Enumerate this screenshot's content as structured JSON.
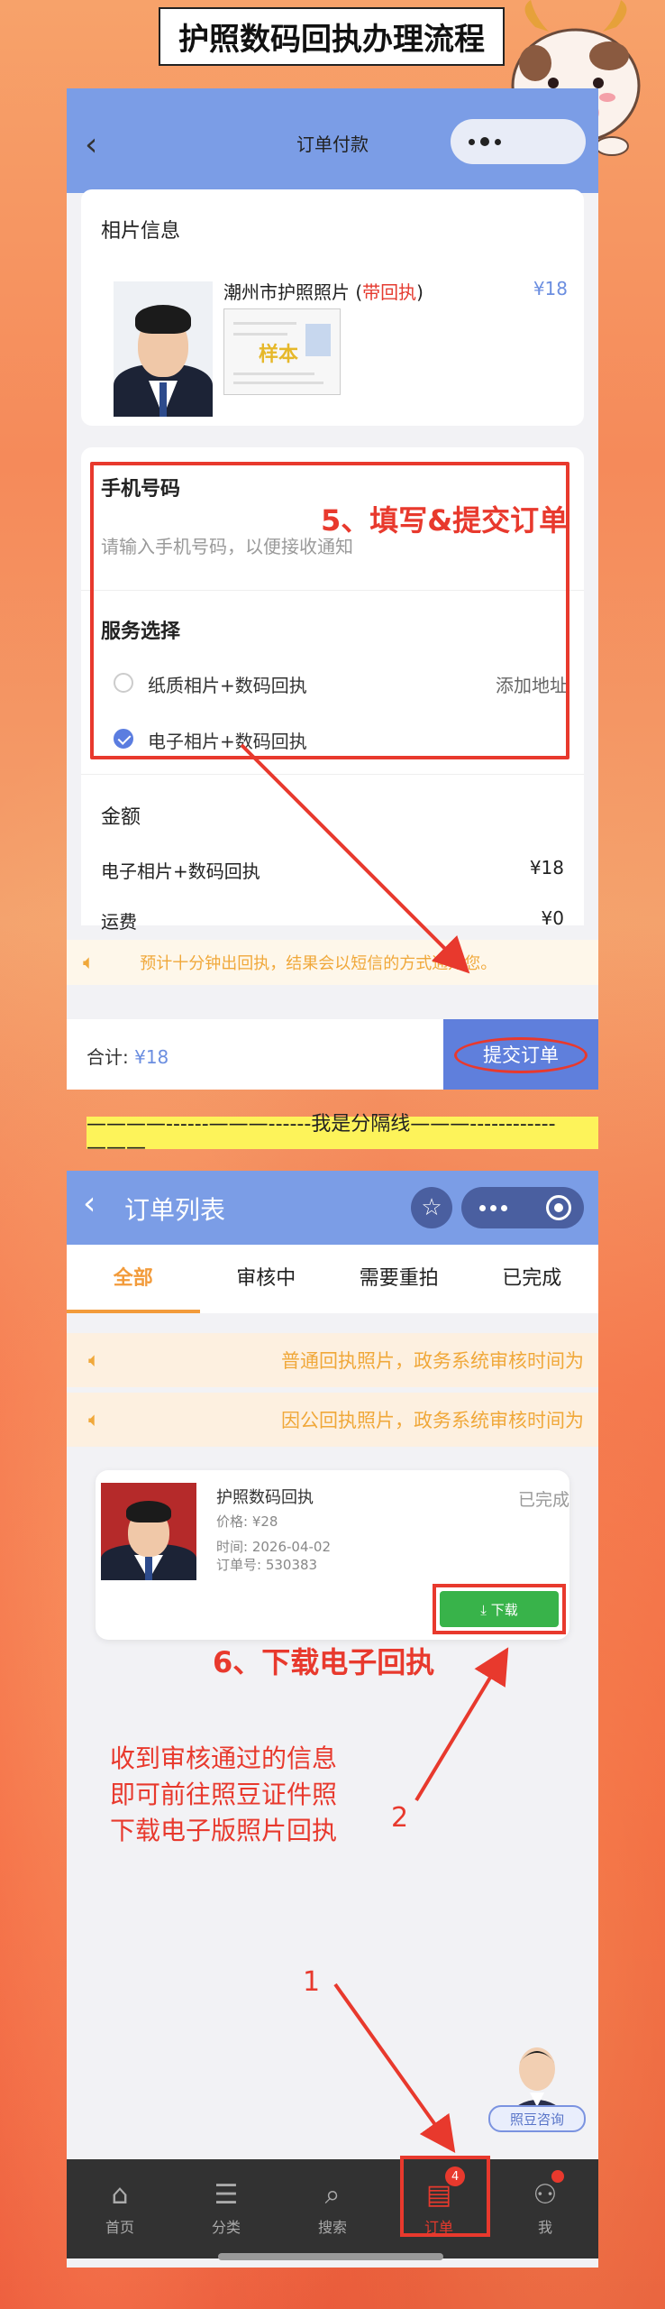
{
  "header": {
    "title": "护照数码回执办理流程"
  },
  "panel1": {
    "nav_title": "订单付款",
    "photo_section": {
      "title": "相片信息",
      "item_name_prefix": "潮州市护照照片 (",
      "item_name_highlight": "带回执",
      "item_name_suffix": ")",
      "price": "¥18",
      "sample_stamp": "样本"
    },
    "step_label": "5、填写&提交订单",
    "phone": {
      "label": "手机号码",
      "placeholder": "请输入手机号码，以便接收通知"
    },
    "service": {
      "label": "服务选择",
      "options": [
        {
          "label": "纸质相片+数码回执",
          "checked": false
        },
        {
          "label": "电子相片+数码回执",
          "checked": true
        }
      ],
      "add_address": "添加地址"
    },
    "amount": {
      "title": "金额",
      "rows": [
        {
          "label": "电子相片+数码回执",
          "value": "¥18"
        },
        {
          "label": "运费",
          "value": "¥0"
        }
      ]
    },
    "notice": "预计十分钟出回执，结果会以短信的方式通知您。",
    "total_label": "合计:",
    "total_value": "¥18",
    "submit_label": "提交订单"
  },
  "separator": "————------———------我是分隔线———------------———",
  "panel2": {
    "nav_title": "订单列表",
    "tabs": [
      "全部",
      "审核中",
      "需要重拍",
      "已完成"
    ],
    "notices": [
      "普通回执照片，政务系统审核时间为",
      "因公回执照片，政务系统审核时间为"
    ],
    "order": {
      "title": "护照数码回执",
      "status": "已完成",
      "price": "价格: ¥28",
      "time": "时间: 2026-04-02",
      "order_no": "订单号: 530383",
      "download_label": "⤓ 下载"
    },
    "step_label": "6、下载电子回执",
    "instructions": [
      "收到审核通过的信息",
      "即可前往照豆证件照",
      "下载电子版照片回执"
    ],
    "marker_2": "2",
    "marker_1": "1",
    "assistant_label": "照豆咨询",
    "tabbar": [
      {
        "label": "首页",
        "icon": "home-icon"
      },
      {
        "label": "分类",
        "icon": "category-icon"
      },
      {
        "label": "搜索",
        "icon": "search-icon"
      },
      {
        "label": "订单",
        "icon": "orders-icon",
        "badge": "4"
      },
      {
        "label": "我",
        "icon": "profile-icon"
      }
    ]
  },
  "colors": {
    "accent_red": "#e8392d",
    "nav_blue": "#7b9de6",
    "tab_orange": "#f29b3b",
    "download_green": "#38b34a"
  }
}
